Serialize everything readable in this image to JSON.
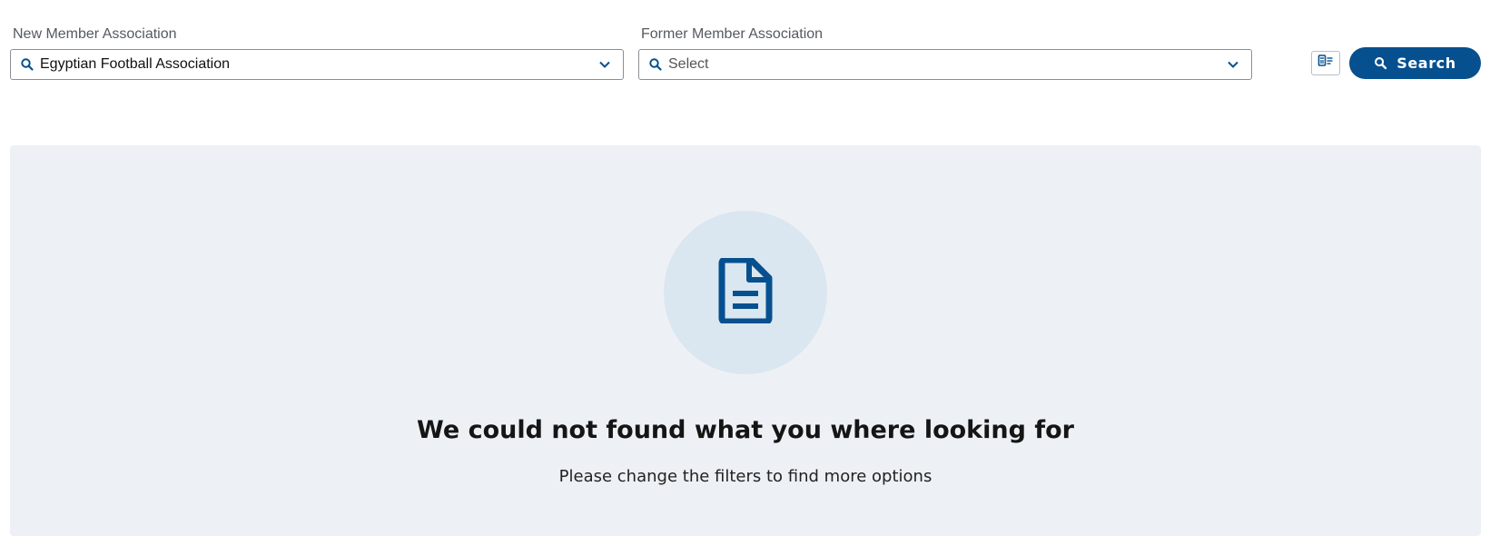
{
  "filters": {
    "new_member": {
      "label": "New Member Association",
      "value": "Egyptian Football Association"
    },
    "former_member": {
      "label": "Former Member Association",
      "placeholder": "Select"
    }
  },
  "actions": {
    "reset_icon": "clear-filters-icon",
    "search_label": "Search"
  },
  "empty_state": {
    "icon": "document-icon",
    "title": "We could not found what you where looking for",
    "subtitle": "Please change the filters to find more options"
  },
  "colors": {
    "brand": "#06508f",
    "panel_bg": "#edf1f5",
    "circle_bg": "#dae6f0"
  }
}
